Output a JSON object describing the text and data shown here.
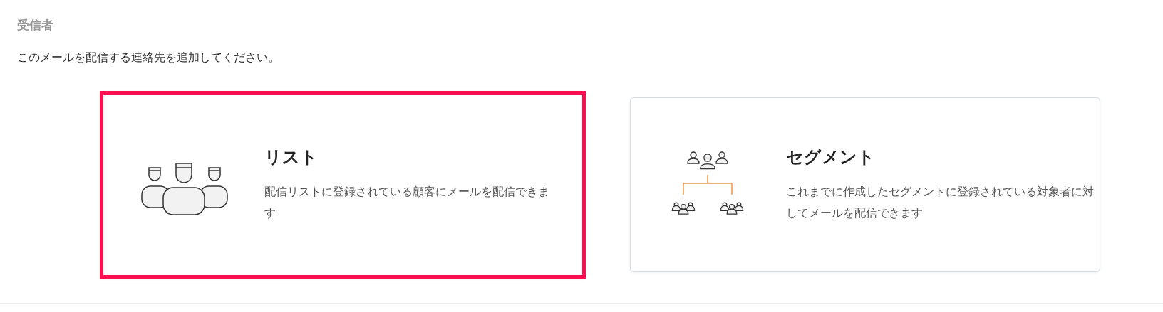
{
  "section_title": "受信者",
  "instruction": "このメールを配信する連絡先を追加してください。",
  "options": [
    {
      "kind": "list",
      "title": "リスト",
      "description": "配信リストに登録されている顧客にメールを配信できます",
      "selected": true
    },
    {
      "kind": "segment",
      "title": "セグメント",
      "description": "これまでに作成したセグメントに登録されている対象者に対してメールを配信できます",
      "selected": false
    }
  ]
}
